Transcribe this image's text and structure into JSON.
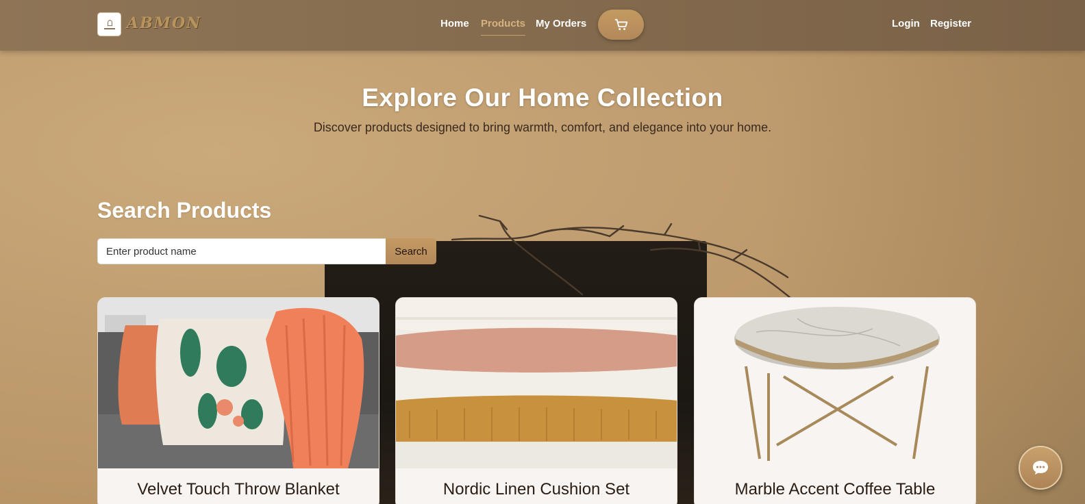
{
  "header": {
    "brand": "ABMON",
    "nav": [
      {
        "label": "Home"
      },
      {
        "label": "Products",
        "active": true
      },
      {
        "label": "My Orders"
      }
    ],
    "cart_icon": "cart-icon",
    "auth": {
      "login": "Login",
      "register": "Register"
    }
  },
  "hero": {
    "title": "Explore Our Home Collection",
    "subtitle": "Discover products designed to bring warmth, comfort, and elegance into your home."
  },
  "search": {
    "title": "Search Products",
    "placeholder": "Enter product name",
    "button": "Search"
  },
  "products": [
    {
      "title": "Velvet Touch Throw Blanket"
    },
    {
      "title": "Nordic Linen Cushion Set"
    },
    {
      "title": "Marble Accent Coffee Table"
    }
  ],
  "chat": {
    "icon": "chat-bubble-icon"
  },
  "colors": {
    "accent": "#c49a62",
    "nav_bg": "#846b4e",
    "active_link": "#d6b27e"
  }
}
